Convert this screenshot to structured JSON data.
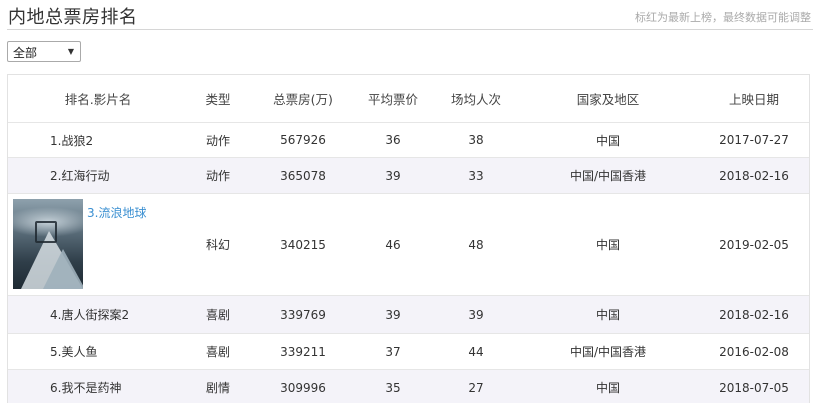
{
  "header": {
    "title": "内地总票房排名",
    "note": "标红为最新上榜，最终数据可能调整"
  },
  "filter": {
    "selected": "全部"
  },
  "table": {
    "columns": [
      "排名.影片名",
      "类型",
      "总票房(万)",
      "平均票价",
      "场均人次",
      "国家及地区",
      "上映日期"
    ],
    "rows": [
      {
        "name": "1.战狼2",
        "type": "动作",
        "total": "567926",
        "price": "36",
        "audience": "38",
        "region": "中国",
        "date": "2017-07-27"
      },
      {
        "name": "2.红海行动",
        "type": "动作",
        "total": "365078",
        "price": "39",
        "audience": "33",
        "region": "中国/中国香港",
        "date": "2018-02-16"
      },
      {
        "name": "3.流浪地球",
        "type": "科幻",
        "total": "340215",
        "price": "46",
        "audience": "48",
        "region": "中国",
        "date": "2019-02-05"
      },
      {
        "name": "4.唐人街探案2",
        "type": "喜剧",
        "total": "339769",
        "price": "39",
        "audience": "39",
        "region": "中国",
        "date": "2018-02-16"
      },
      {
        "name": "5.美人鱼",
        "type": "喜剧",
        "total": "339211",
        "price": "37",
        "audience": "44",
        "region": "中国/中国香港",
        "date": "2016-02-08"
      },
      {
        "name": "6.我不是药神",
        "type": "剧情",
        "total": "309996",
        "price": "35",
        "audience": "27",
        "region": "中国",
        "date": "2018-07-05"
      }
    ]
  }
}
